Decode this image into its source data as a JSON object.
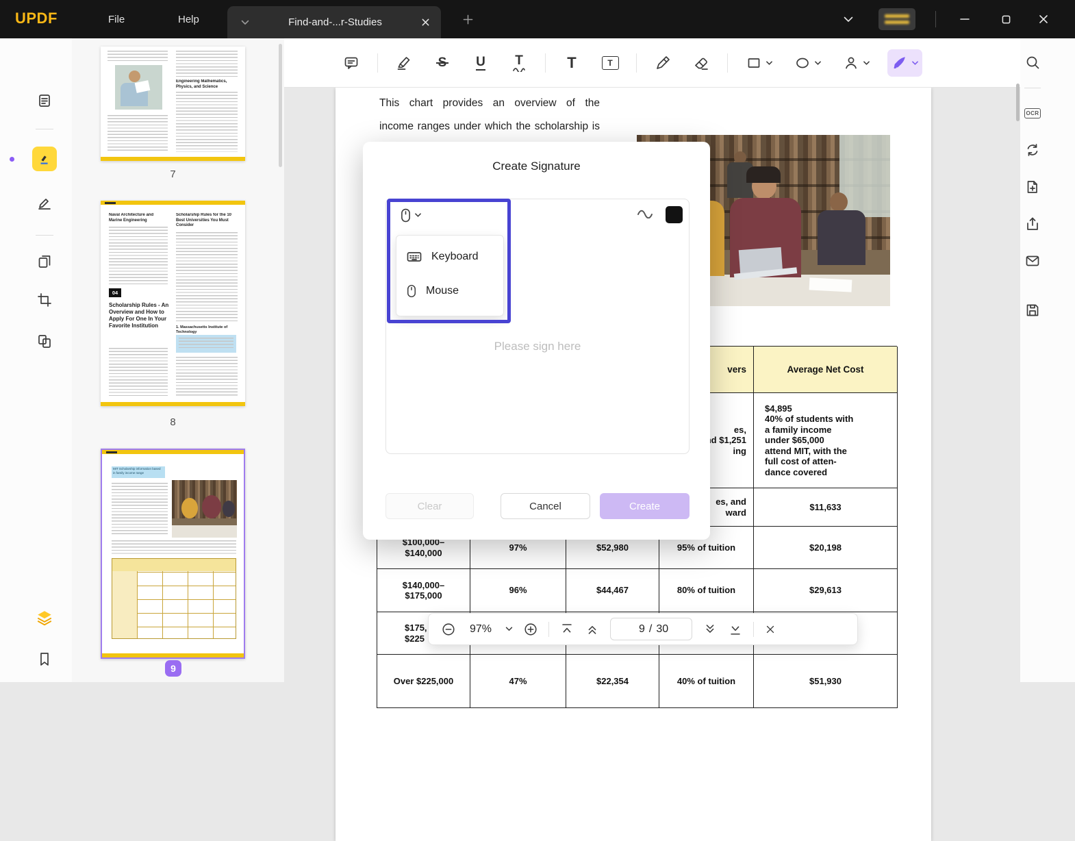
{
  "palette": {
    "accent_purple": "#8b5cf6",
    "selection_blue": "#4843d2",
    "brand_yellow": "#f9b716",
    "create_button": "#cdb9f4",
    "table_header_yellow": "#fbf3c4"
  },
  "titlebar": {
    "logo": "UPDF",
    "file_menu": "File",
    "help_menu": "Help",
    "tab_title": "Find-and-...r-Studies"
  },
  "toolbar": {
    "glyphs": {
      "strikethrough": "S",
      "underline": "U",
      "squiggly": "T",
      "text": "T",
      "textbox": "T"
    }
  },
  "thumbnails": {
    "page7": {
      "label": "7",
      "heading": "Engineering Mathematics, Physics, and Science"
    },
    "page8": {
      "label": "8",
      "left_heading": "Naval Architecture and Marine Engineering",
      "chapter_badge": "04",
      "left_title": "Scholarship Rules - An Overview and How to Apply For One In Your Favorite Institution",
      "right_heading": "Scholarship Rules for the 10 Best Universities You Must Consider",
      "right_item": "1. Massachusetts Institute of Technology"
    },
    "page9": {
      "label": "9",
      "callout": "MIT Scholarship information based in family income range"
    }
  },
  "page": {
    "line1": "This chart provides an overview of the",
    "line2": "income ranges under which the scholarship is",
    "table": {
      "rows": [
        [
          "",
          "",
          "",
          "vers",
          "Average Net Cost"
        ],
        [
          "",
          "",
          "",
          "es,\nnd $1,251\ning",
          "$4,895\n40% of students with\na family income\nunder $65,000\nattend MIT, with the\nfull cost of atten-\ndance covered"
        ],
        [
          "",
          "",
          "",
          "es, and\nward",
          "$11,633"
        ],
        [
          "$100,000–\n$140,000",
          "97%",
          "$52,980",
          "95% of tuition",
          "$20,198"
        ],
        [
          "$140,000–\n$175,000",
          "96%",
          "$44,467",
          "80% of tuition",
          "$29,613"
        ],
        [
          "$175,\n$225",
          "",
          "",
          "",
          ""
        ],
        [
          "Over $225,000",
          "47%",
          "$22,354",
          "40% of tuition",
          "$51,930"
        ]
      ]
    }
  },
  "dialog": {
    "title": "Create Signature",
    "keyboard_option": "Keyboard",
    "mouse_option": "Mouse",
    "placeholder": "Please sign here",
    "clear_label": "Clear",
    "cancel_label": "Cancel",
    "create_label": "Create"
  },
  "zoombar": {
    "zoom_level": "97%",
    "current_page": "9",
    "page_separator": "/",
    "total_pages": "30"
  },
  "right_rail": {
    "ocr_label": "OCR"
  }
}
